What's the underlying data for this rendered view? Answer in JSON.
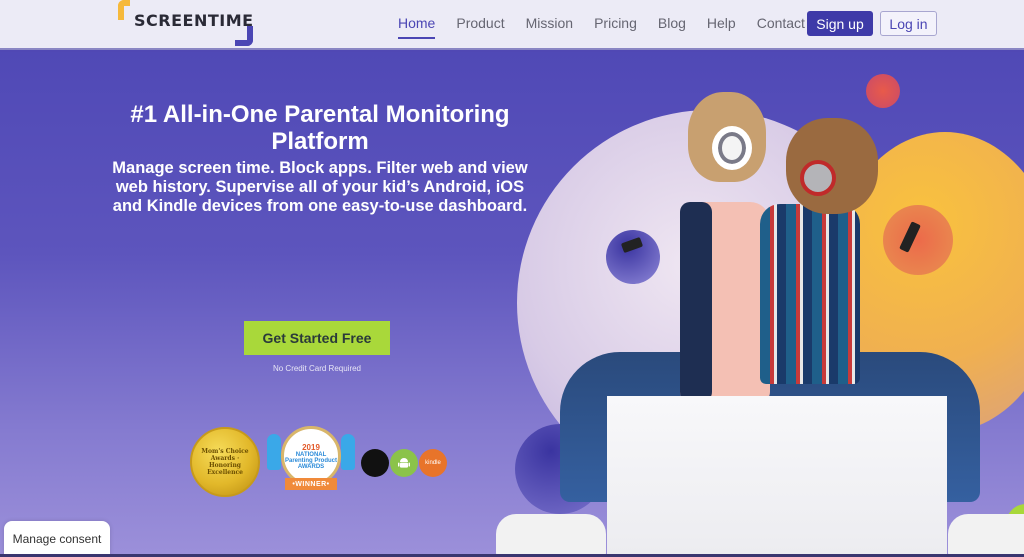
{
  "header": {
    "logo_text": "SCREENTIME",
    "nav": [
      {
        "label": "Home",
        "active": true
      },
      {
        "label": "Product",
        "active": false
      },
      {
        "label": "Mission",
        "active": false
      },
      {
        "label": "Pricing",
        "active": false
      },
      {
        "label": "Blog",
        "active": false
      },
      {
        "label": "Help",
        "active": false
      },
      {
        "label": "Contact",
        "active": false
      }
    ],
    "signup_label": "Sign up",
    "login_label": "Log in"
  },
  "hero": {
    "headline": "#1 All-in-One Parental Monitoring Platform",
    "subtext": "Manage screen time. Block apps. Filter web and view web history. Supervise all of your kid’s Android, iOS and Kindle devices from one easy-to-use dashboard.",
    "cta_label": "Get Started Free",
    "cta_note": "No Credit Card Required",
    "badges": {
      "moms_choice": "Mom's Choice Awards · Honoring Excellence",
      "nappa_year": "2019",
      "nappa_title": "NATIONAL Parenting Product AWARDS",
      "nappa_ribbon": "•WINNER•"
    },
    "platforms": [
      {
        "name": "apple-icon",
        "glyph": ""
      },
      {
        "name": "android-icon",
        "glyph": "🤖"
      },
      {
        "name": "kindle-icon",
        "glyph": "kindle"
      }
    ]
  },
  "colors": {
    "brand_primary": "#4b46b4",
    "brand_accent_yellow": "#f6b93b",
    "cta_green": "#a9d83a",
    "header_bg": "#ecebf6"
  },
  "consent": {
    "label": "Manage consent"
  }
}
